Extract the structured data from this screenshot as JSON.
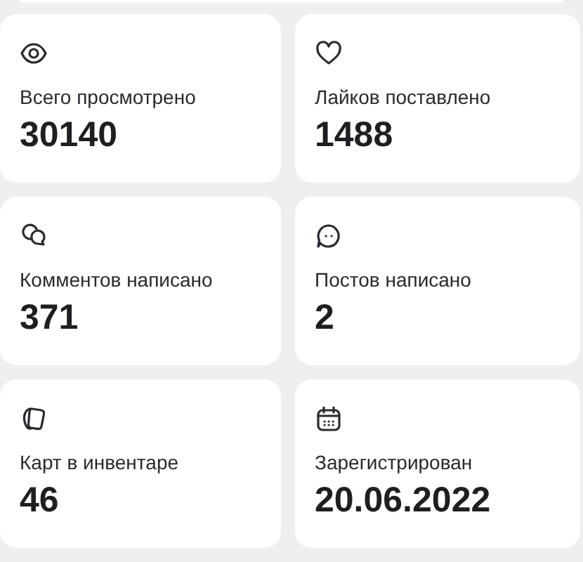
{
  "stats": [
    {
      "kind": "views",
      "label": "Всего просмотрено",
      "value": "30140"
    },
    {
      "kind": "likes",
      "label": "Лайков поставлено",
      "value": "1488"
    },
    {
      "kind": "comments",
      "label": "Комментов написано",
      "value": "371"
    },
    {
      "kind": "posts",
      "label": "Постов написано",
      "value": "2"
    },
    {
      "kind": "cards",
      "label": "Карт в инвентаре",
      "value": "46"
    },
    {
      "kind": "registered",
      "label": "Зарегистрирован",
      "value": "20.06.2022"
    }
  ]
}
